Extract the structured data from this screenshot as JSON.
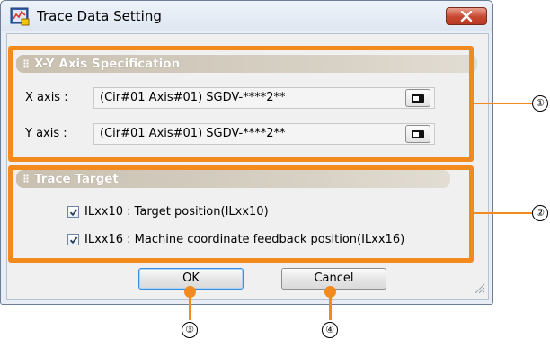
{
  "window": {
    "title": "Trace Data Setting",
    "app_icon": "trace-app-icon",
    "close_icon": "close-x-icon"
  },
  "xy_axis": {
    "header": "X-Y Axis Specification",
    "x_label": "X axis :",
    "x_value": "(Cir#01 Axis#01) SGDV-****2**",
    "y_label": "Y axis :",
    "y_value": "(Cir#01 Axis#01) SGDV-****2**",
    "browse_icon": "browse-icon"
  },
  "trace_target": {
    "header": "Trace Target",
    "items": [
      {
        "label": "ILxx10 : Target position(ILxx10)",
        "checked": true
      },
      {
        "label": "ILxx16 : Machine coordinate feedback position(ILxx16)",
        "checked": true
      }
    ]
  },
  "buttons": {
    "ok": "OK",
    "cancel": "Cancel"
  },
  "callouts": [
    "①",
    "②",
    "③",
    "④"
  ],
  "colors": {
    "callout": "#f28a1e",
    "close_button": "#c8472f",
    "group_header": "#d8d2c6"
  }
}
